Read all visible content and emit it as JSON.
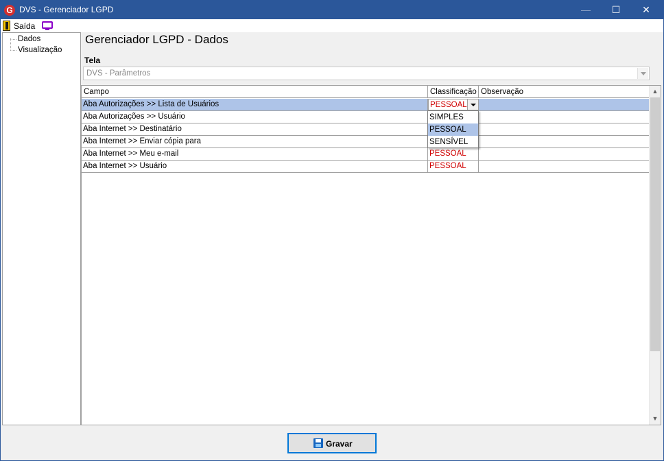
{
  "window": {
    "title": "DVS - Gerenciador LGPD",
    "icon": "dvs-logo-icon",
    "icon_letter": "G",
    "controls": {
      "minimize": "—",
      "maximize": "☐",
      "close": "✕"
    }
  },
  "menu": {
    "exit_label": "Saída",
    "exit_icon": "exit-door-icon",
    "monitor_icon": "monitor-icon"
  },
  "sidebar": {
    "items": [
      {
        "label": "Dados"
      },
      {
        "label": "Visualização"
      }
    ]
  },
  "main": {
    "title": "Gerenciador LGPD - Dados",
    "tela_label": "Tela",
    "tela_value": "DVS - Parâmetros"
  },
  "grid": {
    "columns": [
      "Campo",
      "Classificação",
      "Observação"
    ],
    "rows": [
      {
        "campo": "Aba Autorizações >> Lista de Usuários",
        "classificacao": "PESSOAL",
        "observacao": "",
        "selected": true,
        "editing": true
      },
      {
        "campo": "Aba Autorizações >> Usuário",
        "classificacao": "",
        "observacao": ""
      },
      {
        "campo": "Aba Internet >> Destinatário",
        "classificacao": "",
        "observacao": ""
      },
      {
        "campo": "Aba Internet >> Enviar cópia para",
        "classificacao": "",
        "observacao": ""
      },
      {
        "campo": "Aba Internet >> Meu e-mail",
        "classificacao": "PESSOAL",
        "observacao": ""
      },
      {
        "campo": "Aba Internet >> Usuário",
        "classificacao": "PESSOAL",
        "observacao": ""
      }
    ],
    "dropdown_options": [
      "SIMPLES",
      "PESSOAL",
      "SENSÍVEL"
    ],
    "dropdown_highlighted": "PESSOAL"
  },
  "footer": {
    "save_label": "Gravar",
    "save_icon": "floppy-disk-icon"
  },
  "colors": {
    "titlebar": "#2b579a",
    "selection": "#aec4e8",
    "classification_text": "#d00000"
  }
}
